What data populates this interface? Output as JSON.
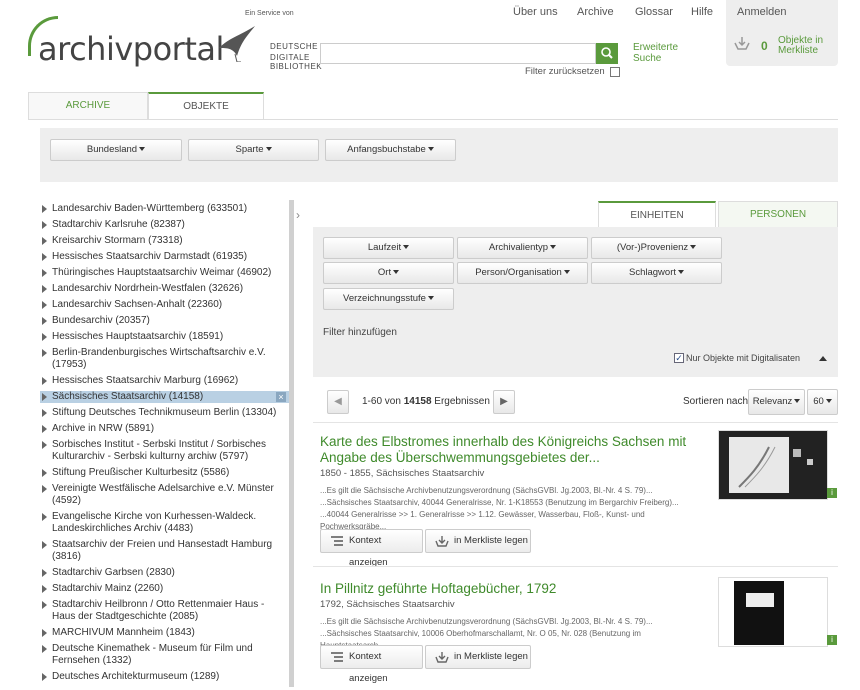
{
  "brand": {
    "logo": "archivportal",
    "ddb_small": "Ein Service von",
    "ddb_line1": "DEUTSCHE",
    "ddb_line2": "DIGITALE BIBLIOTHEK"
  },
  "nav": {
    "about": "Über uns",
    "archive": "Archive",
    "glossary": "Glossar",
    "help": "Hilfe",
    "login": "Anmelden"
  },
  "memo": {
    "count": "0",
    "label1": "Objekte in",
    "label2": "Merkliste"
  },
  "search": {
    "placeholder": "",
    "advanced1": "Erweiterte",
    "advanced2": "Suche",
    "reset": "Filter zurücksetzen"
  },
  "tabs": {
    "archive": "ARCHIVE",
    "objects": "OBJEKTE"
  },
  "filters": {
    "state": "Bundesland",
    "sector": "Sparte",
    "letter": "Anfangsbuchstabe"
  },
  "archives": [
    "Landesarchiv Baden-Württemberg (633501)",
    "Stadtarchiv Karlsruhe (82387)",
    "Kreisarchiv Stormarn (73318)",
    "Hessisches Staatsarchiv Darmstadt (61935)",
    "Thüringisches Hauptstaatsarchiv Weimar (46902)",
    "Landesarchiv Nordrhein-Westfalen (32626)",
    "Landesarchiv Sachsen-Anhalt (22360)",
    "Bundesarchiv (20357)",
    "Hessisches Hauptstaatsarchiv (18591)",
    "Berlin-Brandenburgisches Wirtschaftsarchiv e.V. (17953)",
    "Hessisches Staatsarchiv Marburg (16962)",
    "Sächsisches Staatsarchiv (14158)",
    "Stiftung Deutsches Technikmuseum Berlin (13304)",
    "Archive in NRW (5891)",
    "Sorbisches Institut - Serbski Institut / Sorbisches Kulturarchiv - Serbski kulturny archiw (5797)",
    "Stiftung Preußischer Kulturbesitz (5586)",
    "Vereinigte Westfälische Adelsarchive e.V. Münster (4592)",
    "Evangelische Kirche von Kurhessen-Waldeck. Landeskirchliches Archiv (4483)",
    "Staatsarchiv der Freien und Hansestadt Hamburg (3816)",
    "Stadtarchiv Garbsen (2830)",
    "Stadtarchiv Mainz (2260)",
    "Stadtarchiv Heilbronn / Otto Rettenmaier Haus - Haus der Stadtgeschichte (2085)",
    "MARCHIVUM Mannheim (1843)",
    "Deutsche Kinemathek - Museum für Film und Fernsehen (1332)",
    "Deutsches Architekturmuseum (1289)"
  ],
  "rtabs": {
    "units": "EINHEITEN",
    "persons": "PERSONEN"
  },
  "facets": {
    "runtime": "Laufzeit",
    "type": "Archivalientyp",
    "provenance": "(Vor-)Provenienz",
    "place": "Ort",
    "person": "Person/Organisation",
    "keyword": "Schlagwort",
    "level": "Verzeichnungsstufe",
    "add_filter": "Filter hinzufügen",
    "digital_only": "Nur Objekte mit Digitalisaten"
  },
  "pager": {
    "range": "1-60 von ",
    "total": "14158",
    "suffix": " Ergebnissen",
    "sort_label": "Sortieren nach",
    "sort_value": "Relevanz",
    "per_page": "60"
  },
  "results": [
    {
      "title": "Karte des Elbstromes innerhalb des Königreichs Sachsen mit Angabe des Überschwemmungsgebietes der...",
      "meta": "1850 - 1855, Sächsisches Staatsarchiv",
      "snippet": "...Es gilt die Sächsische Archivbenutzungsverordnung (SächsGVBl. Jg.2003, Bl.-Nr. 4 S. 79)... ...Sächsisches Staatsarchiv, 40044 Generalrisse, Nr. 1-K18553 (Benutzung im Bergarchiv Freiberg)... ...40044 Generalrisse >> 1. Generalrisse >> 1.12. Gewässer, Wasserbau, Floß-, Kunst- und Pochwerksgräbe...",
      "ctx": "Kontext anzeigen",
      "memo": "in Merkliste legen"
    },
    {
      "title": "In Pillnitz geführte Hoftagebücher, 1792",
      "meta": "1792, Sächsisches Staatsarchiv",
      "snippet": "...Es gilt die Sächsische Archivbenutzungsverordnung (SächsGVBl. Jg.2003, Bl.-Nr. 4 S. 79)... ...Sächsisches Staatsarchiv, 10006 Oberhofmarschallamt, Nr. O 05, Nr. 028 (Benutzung im Hauptstaatsarch...",
      "ctx": "Kontext anzeigen",
      "memo": "in Merkliste legen"
    }
  ],
  "colors": {
    "accent": "#5a9a3c",
    "link": "#3f8a2b",
    "selected": "#b9d0e3"
  }
}
